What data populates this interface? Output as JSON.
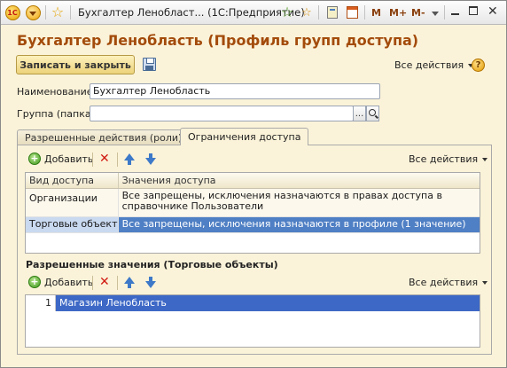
{
  "titlebar": {
    "title": "Бухгалтер Ленобласт... (1С:Предприятие)",
    "logo_text": "1С",
    "mem_labels": [
      "M",
      "M+",
      "M-"
    ]
  },
  "header": {
    "form_title": "Бухгалтер Ленобласть (Профиль групп доступа)",
    "save_close_label": "Записать и закрыть",
    "all_actions_label": "Все действия",
    "help_label": "?"
  },
  "fields": {
    "name_label": "Наименование:",
    "name_value": "Бухгалтер Ленобласть",
    "group_label": "Группа (папка):",
    "group_value": "",
    "select_button": "..."
  },
  "tabs": [
    {
      "label": "Разрешенные действия (роли)",
      "active": false
    },
    {
      "label": "Ограничения доступа",
      "active": true
    }
  ],
  "toolbar1": {
    "add_label": "Добавить",
    "all_actions_label": "Все действия"
  },
  "access_table": {
    "columns": [
      "Вид доступа",
      "Значения доступа"
    ],
    "rows": [
      {
        "kind": "Организации",
        "values": "Все запрещены, исключения назначаются в правах доступа в справочнике Пользователи"
      },
      {
        "kind": "Торговые объекты",
        "values": "Все запрещены, исключения назначаются в профиле (1 значение)"
      }
    ]
  },
  "allowed_section": {
    "title": "Разрешенные значения (Торговые объекты)",
    "add_label": "Добавить",
    "all_actions_label": "Все действия",
    "rows": [
      {
        "num": "1",
        "value": "Магазин Ленобласть"
      }
    ]
  },
  "colors": {
    "title": "#a34b0b",
    "background": "#fbf3d9",
    "selection": "#4f7fc4"
  }
}
